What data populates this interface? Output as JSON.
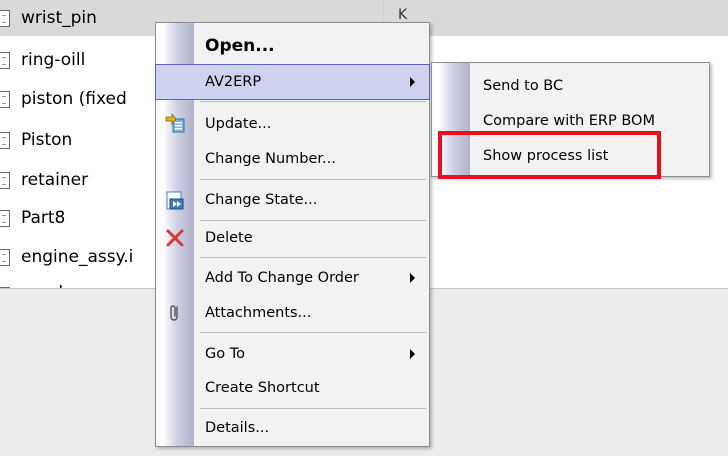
{
  "file_list": {
    "rows": [
      {
        "name": "wrist_pin",
        "col2": "K"
      },
      {
        "name": "ring-oill"
      },
      {
        "name": "piston (fixed"
      },
      {
        "name": "Piston"
      },
      {
        "name": "retainer"
      },
      {
        "name": "Part8"
      },
      {
        "name": "engine_assy.i"
      },
      {
        "name": "crank"
      }
    ]
  },
  "context_menu": {
    "items": [
      {
        "label": "Open..."
      },
      {
        "label": "AV2ERP"
      },
      {
        "label": "Update..."
      },
      {
        "label": "Change Number..."
      },
      {
        "label": "Change State..."
      },
      {
        "label": "Delete"
      },
      {
        "label": "Add To Change Order"
      },
      {
        "label": "Attachments..."
      },
      {
        "label": "Go To"
      },
      {
        "label": "Create Shortcut"
      },
      {
        "label": "Details..."
      }
    ]
  },
  "submenu": {
    "items": [
      {
        "label": "Send to BC"
      },
      {
        "label": "Compare with ERP BOM"
      },
      {
        "label": "Show process list"
      }
    ]
  },
  "colors": {
    "highlight_bg": "#cfd2ef",
    "highlight_border": "#5a61b8",
    "annotation_red": "#e8101c",
    "menu_bg": "#f2f2f2"
  }
}
